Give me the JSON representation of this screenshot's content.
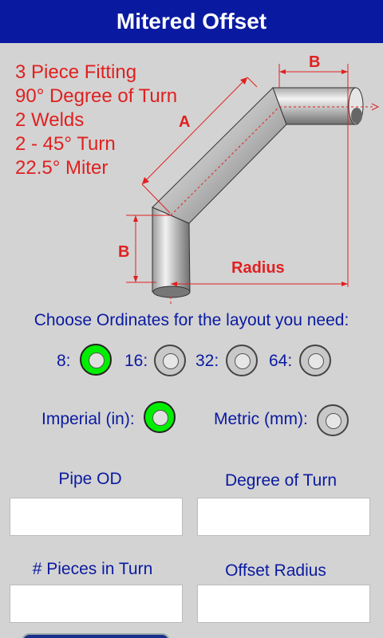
{
  "title": "Mitered Offset",
  "specs": [
    "3 Piece Fitting",
    "90° Degree of Turn",
    "2 Welds",
    "2 - 45° Turn",
    "22.5° Miter"
  ],
  "diagram": {
    "label_a": "A",
    "label_b_top": "B",
    "label_b_left": "B",
    "label_radius": "Radius"
  },
  "instruction": "Choose Ordinates for the layout you need:",
  "ordinates": [
    {
      "label": "8:",
      "selected": true
    },
    {
      "label": "16:",
      "selected": false
    },
    {
      "label": "32:",
      "selected": false
    },
    {
      "label": "64:",
      "selected": false
    }
  ],
  "units": [
    {
      "label": "Imperial (in):",
      "selected": true
    },
    {
      "label": "Metric (mm):",
      "selected": false
    }
  ],
  "fields": {
    "pipe_od": {
      "label": "Pipe OD",
      "value": ""
    },
    "degree_of_turn": {
      "label": "Degree of Turn",
      "value": ""
    },
    "pieces_in_turn": {
      "label": "# Pieces in Turn",
      "value": ""
    },
    "offset_radius": {
      "label": "Offset Radius",
      "value": ""
    }
  },
  "colors": {
    "title_bar": "#0a1aa0",
    "accent_red": "#e02020",
    "selected": "#00ee00"
  }
}
